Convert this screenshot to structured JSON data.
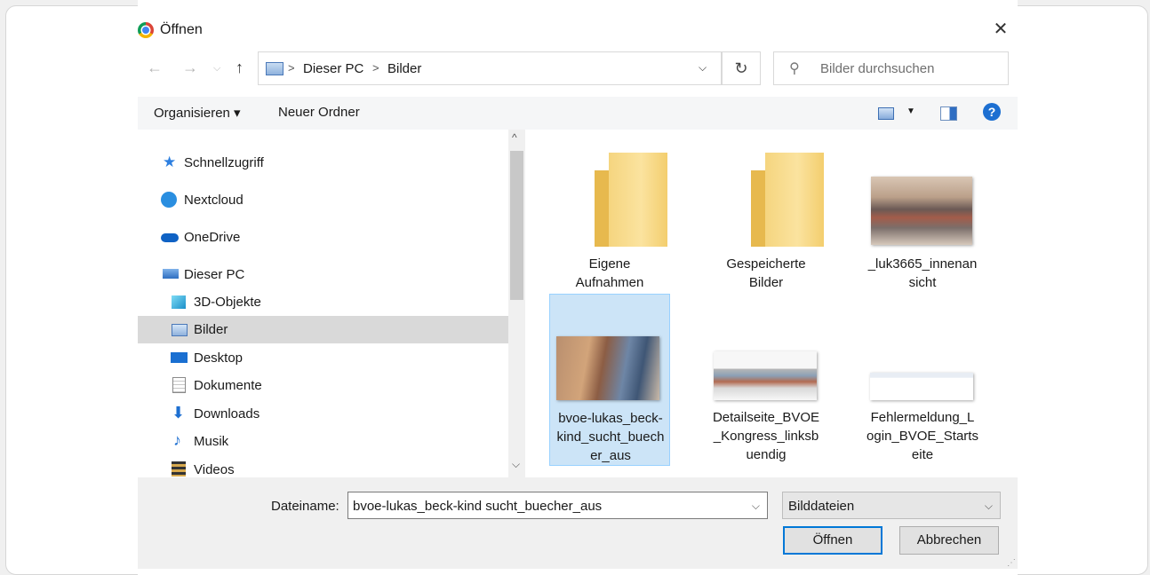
{
  "window": {
    "title": "Öffnen"
  },
  "nav": {
    "back_icon": "arrow-left-icon",
    "path": [
      "Dieser PC",
      "Bilder"
    ],
    "search_placeholder": "Bilder durchsuchen"
  },
  "toolbar": {
    "organize_label": "Organisieren ▾",
    "new_folder_label": "Neuer Ordner",
    "help_label": "?"
  },
  "sidebar": {
    "items": [
      {
        "label": "Schnellzugriff",
        "icon": "star-icon"
      },
      {
        "label": "Nextcloud",
        "icon": "nextcloud-icon"
      },
      {
        "label": "OneDrive",
        "icon": "cloud-icon"
      },
      {
        "label": "Dieser PC",
        "icon": "computer-icon"
      },
      {
        "label": "3D-Objekte",
        "icon": "cube-icon"
      },
      {
        "label": "Bilder",
        "icon": "pictures-icon",
        "selected": true
      },
      {
        "label": "Desktop",
        "icon": "desktop-icon"
      },
      {
        "label": "Dokumente",
        "icon": "document-icon"
      },
      {
        "label": "Downloads",
        "icon": "download-icon"
      },
      {
        "label": "Musik",
        "icon": "music-icon"
      },
      {
        "label": "Videos",
        "icon": "video-icon"
      }
    ]
  },
  "files": [
    {
      "name": "Eigene Aufnahmen",
      "line1": "Eigene",
      "line2": "Aufnahmen",
      "type": "folder"
    },
    {
      "name": "Gespeicherte Bilder",
      "line1": "Gespeicherte",
      "line2": "Bilder",
      "type": "folder"
    },
    {
      "name": "_luk3665_innenansicht",
      "line1": "_luk3665_innenan",
      "line2": "sicht",
      "type": "image"
    },
    {
      "name": "bvoe-lukas_beck-kind_sucht_buecher_aus",
      "line1": "bvoe-lukas_beck-",
      "line2": "kind_sucht_buech",
      "line3": "er_aus",
      "type": "image",
      "selected": true
    },
    {
      "name": "Detailseite_BVOE_Kongress_linksbuendig",
      "line1": "Detailseite_BVOE",
      "line2": "_Kongress_linksb",
      "line3": "uendig",
      "type": "image"
    },
    {
      "name": "Fehlermeldung_Login_BVOE_Startseite",
      "line1": "Fehlermeldung_L",
      "line2": "ogin_BVOE_Starts",
      "line3": "eite",
      "type": "image"
    }
  ],
  "footer": {
    "filename_label": "Dateiname:",
    "filename_value": "bvoe-lukas_beck-kind sucht_buecher_aus",
    "filter_value": "Bilddateien",
    "open_label": "Öffnen",
    "cancel_label": "Abbrechen"
  }
}
